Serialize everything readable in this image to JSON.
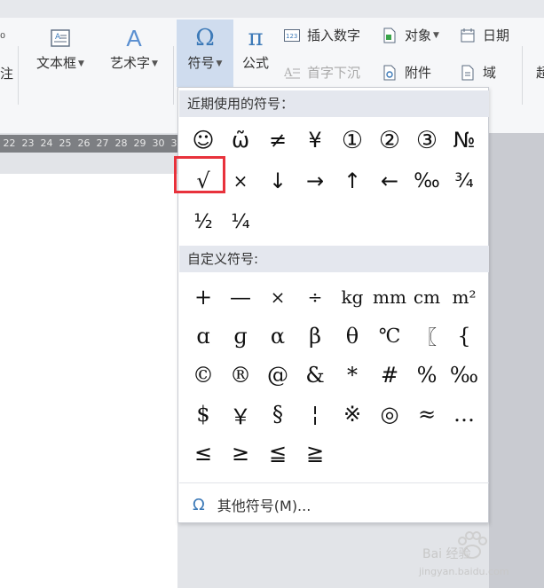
{
  "ribbon": {
    "left_cut_top": "⁰",
    "left_cut_bottom": "注",
    "textbox_label": "文本框",
    "wordart_label": "艺术字",
    "symbol_label": "符号",
    "formula_label": "公式",
    "insert_number": "插入数字",
    "dropcap": "首字下沉",
    "object": "对象",
    "attachment": "附件",
    "date": "日期",
    "field": "域",
    "right_cut": "超",
    "symbol_glyph": "Ω",
    "formula_glyph": "π",
    "wordart_glyph": "A"
  },
  "ruler": {
    "numbers": [
      "22",
      "23",
      "24",
      "25",
      "26",
      "27",
      "28",
      "29",
      "30",
      "31"
    ]
  },
  "menu": {
    "recent_header": "近期使用的符号：",
    "recent_symbols": [
      "☺",
      "ω̃",
      "≠",
      "¥",
      "①",
      "②",
      "③",
      "№",
      "√",
      "×",
      "↓",
      "→",
      "↑",
      "←",
      "‰",
      "¾",
      "½",
      "¼"
    ],
    "custom_header": "自定义符号:",
    "custom_symbols": [
      "+",
      "—",
      "×",
      "÷",
      "kg",
      "mm",
      "cm",
      "m²",
      "ɑ",
      "ɡ",
      "α",
      "β",
      "θ",
      "℃",
      "〖",
      "{",
      "©",
      "®",
      "@",
      "&",
      "*",
      "#",
      "%",
      "‰",
      "$",
      "￥",
      "§",
      "¦",
      "※",
      "◎",
      "≈",
      "…",
      "≤",
      "≥",
      "≦",
      "≧"
    ],
    "other_symbols_label": "其他符号(M)...",
    "other_symbols_icon": "Ω"
  },
  "watermark": {
    "logo_text": "Bai 经验",
    "url_text": "jingyan.baidu.com"
  },
  "colors": {
    "highlight_border": "#e8323c",
    "selected_button_bg": "#cfdcee",
    "section_header_bg": "#e4e7ee",
    "accent_blue": "#3d7ab8"
  }
}
